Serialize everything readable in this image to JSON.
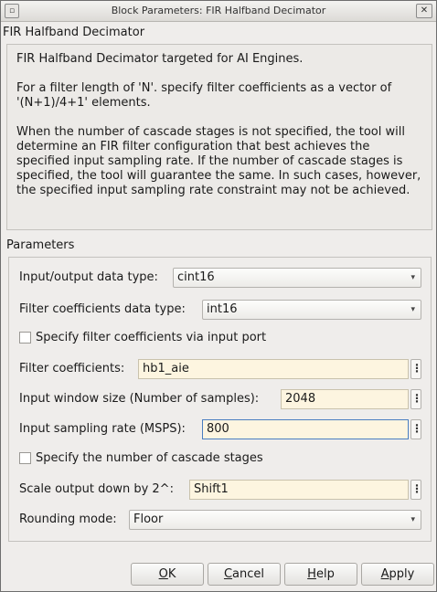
{
  "window": {
    "title": "Block Parameters: FIR Halfband Decimator",
    "menu_glyph": "▫",
    "close_glyph": "✕"
  },
  "block_name": "FIR Halfband Decimator",
  "description": [
    "FIR Halfband Decimator targeted for AI Engines.",
    "For a filter length of 'N'. specify filter coefficients as a vector of '(N+1)/4+1' elements.",
    "When the number of cascade stages is not specified, the tool will determine an FIR filter configuration that best achieves the specified input sampling rate. If the number of cascade stages is specified, the tool will guarantee the same. In such cases, however, the specified input sampling rate constraint may not be achieved."
  ],
  "parameters": {
    "section_label": "Parameters",
    "io_type": {
      "label": "Input/output data type:",
      "value": "cint16"
    },
    "coef_type": {
      "label": "Filter coefficients data type:",
      "value": "int16"
    },
    "coef_via_port": {
      "label": "Specify filter coefficients via input port",
      "checked": false
    },
    "coefficients": {
      "label": "Filter coefficients:",
      "value": "hb1_aie"
    },
    "window_size": {
      "label": "Input window size (Number of samples):",
      "value": "2048"
    },
    "sampling_rate": {
      "label": "Input sampling rate (MSPS):",
      "value": "800"
    },
    "cascade_stages": {
      "label": "Specify the number of cascade stages",
      "checked": false
    },
    "scale_output": {
      "label": "Scale output down by 2^:",
      "value": "Shift1"
    },
    "rounding": {
      "label": "Rounding mode:",
      "value": "Floor"
    }
  },
  "icons": {
    "dropdown": "▾",
    "more": "⋮"
  },
  "buttons": {
    "ok": {
      "key": "O",
      "rest": "K"
    },
    "cancel": {
      "key": "C",
      "rest": "ancel"
    },
    "help": {
      "key": "H",
      "rest": "elp"
    },
    "apply": {
      "key": "A",
      "rest": "pply"
    }
  },
  "colors": {
    "edit_background": "#fdf5e0",
    "focus_border": "#4a7ec0",
    "dialog_background": "#efedeb"
  }
}
